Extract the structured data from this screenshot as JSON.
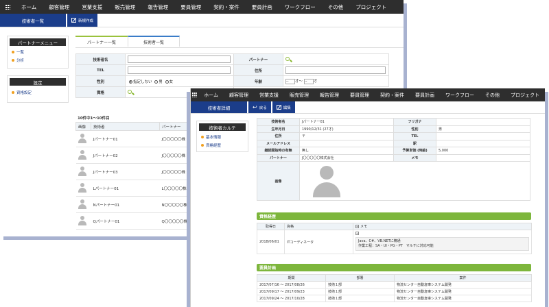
{
  "nav": [
    "ホーム",
    "顧客管理",
    "営業支援",
    "販売管理",
    "報告管理",
    "要員管理",
    "契約・案件",
    "要員計画",
    "ワークフロー",
    "その他",
    "プロジェクト"
  ],
  "win1": {
    "title": "技術者一覧",
    "new_button": "新規作成",
    "partner_menu": {
      "head": "パートナーメニュー",
      "items": [
        "一覧",
        "分析"
      ]
    },
    "settings_menu": {
      "head": "設定",
      "items": [
        "資格設定"
      ]
    },
    "tabs": [
      "パートナー一覧",
      "技術者一覧"
    ],
    "form": {
      "name_label": "技術者名",
      "partner_label": "パートナー",
      "tel_label": "TEL",
      "address_label": "住所",
      "gender_label": "性別",
      "gender_options": [
        "指定しない",
        "男",
        "女"
      ],
      "age_label": "年齢",
      "age_from_unit": "才〜",
      "age_to_unit": "才",
      "age_select": "--",
      "qual_label": "資格"
    },
    "count_text": "10件中1〜10件目",
    "list": {
      "headers": [
        "画像",
        "技術者",
        "パートナー"
      ],
      "rows": [
        {
          "name": "Jパートナー01",
          "partner": "J〇〇〇〇〇株"
        },
        {
          "name": "Jパートナー02",
          "partner": "J〇〇〇〇〇株"
        },
        {
          "name": "Jパートナー03",
          "partner": "J〇〇〇〇〇株"
        },
        {
          "name": "Lパートナー01",
          "partner": "L〇〇〇〇〇株"
        },
        {
          "name": "Nパートナー01",
          "partner": "N〇〇〇〇〇株"
        },
        {
          "name": "Qパートナー01",
          "partner": "Q〇〇〇〇〇株"
        }
      ]
    }
  },
  "win2": {
    "title": "技術者詳細",
    "back_button": "戻る",
    "edit_button": "編集",
    "side_menu": {
      "head": "技術者カルテ",
      "items": [
        "基本情報",
        "資格経歴"
      ]
    },
    "detail": {
      "name_label": "技術者名",
      "name_value": "Jパートナー01",
      "furigana_label": "フリガナ",
      "furigana_value": "",
      "birth_label": "生年月日",
      "birth_value": "1990/12/31 (27才)",
      "gender_label": "性別",
      "gender_value": "男",
      "address_label": "住所",
      "address_value": "〒",
      "tel_label": "TEL",
      "tel_value": "",
      "mail_label": "メールアドレス",
      "mail_value": "",
      "station_label": "駅",
      "station_value": "",
      "contract_label": "継続開始時の有無",
      "contract_value": "無し",
      "price_label": "予算単価 (時給)",
      "price_value": "5,000",
      "partner_label": "パートナー",
      "partner_value": "J〇〇〇〇〇株式会社",
      "memo_label": "メモ",
      "memo_value": "",
      "photo_label": "画像"
    },
    "qual_section": {
      "title": "資格経歴",
      "headers": [
        "取得日",
        "資格",
        "メモ"
      ],
      "row": {
        "date": "2018/06/01",
        "qual": "ITコーディネータ",
        "memo_lines": [
          "Java、C#、VB.NETに精通",
          "作業工程：SA・UI・PG・PT　マルチに対応可能"
        ]
      }
    },
    "plan_section": {
      "title": "要員計画",
      "headers": [
        "期間",
        "部署",
        "案件"
      ],
      "rows": [
        {
          "period": "2017/07/16 〜 2017/08/26",
          "dept": "技術１部",
          "project": "物流センター自動倉庫システム開発"
        },
        {
          "period": "2017/09/17 〜 2017/09/23",
          "dept": "技術１部",
          "project": "物流センター自動倉庫システム開発"
        },
        {
          "period": "2017/09/24 〜 2017/10/28",
          "dept": "技術１部",
          "project": "物流センター自動倉庫システム開発"
        }
      ]
    }
  }
}
